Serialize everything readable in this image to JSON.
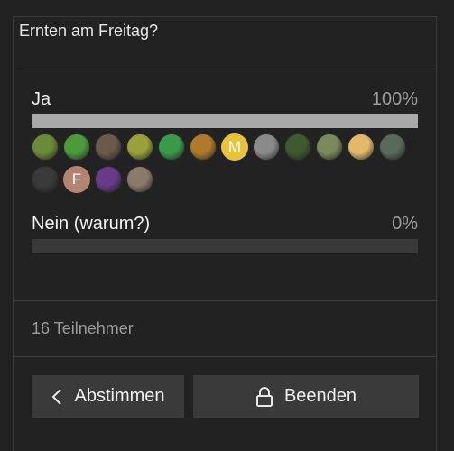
{
  "poll": {
    "title": "Ernten am Freitag?",
    "options": [
      {
        "label": "Ja",
        "percent_text": "100%",
        "fraction": 1.0
      },
      {
        "label": "Nein (warum?)",
        "percent_text": "0%",
        "fraction": 0.0
      }
    ],
    "voters": [
      {
        "icon": "avatar-plant-photo",
        "color": "#6b8a3a"
      },
      {
        "icon": "avatar-green-frog",
        "color": "#4d9a3a"
      },
      {
        "icon": "avatar-person-photo",
        "color": "#6a5a4a"
      },
      {
        "icon": "avatar-bird-photo",
        "color": "#9aa03a"
      },
      {
        "icon": "avatar-character",
        "color": "#3a9a4a"
      },
      {
        "icon": "avatar-pattern",
        "color": "#b07a2a"
      },
      {
        "icon": "avatar-letter",
        "letter": "M",
        "color": "#e8c33a"
      },
      {
        "icon": "avatar-landscape",
        "color": "#8a8a8a"
      },
      {
        "icon": "avatar-cannabis-plant",
        "color": "#3f5a2f"
      },
      {
        "icon": "avatar-bud-photo",
        "color": "#7a8a5a"
      },
      {
        "icon": "avatar-cartoon-character",
        "color": "#e2b86a"
      },
      {
        "icon": "avatar-animal-photo",
        "color": "#5a6a5a"
      },
      {
        "icon": "avatar-dark-photo",
        "color": "#3a3a3a"
      },
      {
        "icon": "avatar-letter",
        "letter": "F",
        "color": "#b38470"
      },
      {
        "icon": "avatar-purple-bud",
        "color": "#6a3a8a"
      },
      {
        "icon": "avatar-face-photo",
        "color": "#8a7a6a"
      }
    ],
    "participants_text": "16 Teilnehmer"
  },
  "buttons": {
    "vote_label": "Abstimmen",
    "close_label": "Beenden"
  }
}
